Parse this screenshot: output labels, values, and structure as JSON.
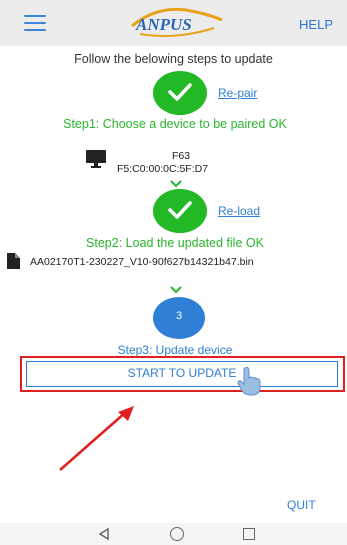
{
  "header": {
    "logo_text": "ANPUS",
    "help_label": "HELP"
  },
  "instruction": "Follow the belowing steps to update",
  "step1": {
    "link_label": "Re-pair",
    "text": "Step1: Choose a device to be paired OK",
    "device_name": "F63",
    "device_mac": "F5:C0:00:0C:5F:D7"
  },
  "step2": {
    "link_label": "Re-load",
    "text": "Step2: Load the updated file OK",
    "file_name": "AA02170T1-230227_V10-90f627b14321b47.bin"
  },
  "step3": {
    "number": "3",
    "text": "Step3: Update device",
    "button_label": "START TO UPDATE"
  },
  "quit_label": "QUIT",
  "colors": {
    "success_green": "#22b826",
    "accent_blue": "#2f7fd6",
    "highlight_red": "#e02020"
  },
  "icons": {
    "menu": "hamburger-menu-icon",
    "check": "check-icon",
    "monitor": "monitor-icon",
    "file": "file-icon",
    "chevron": "chevron-down-icon",
    "hand": "pointing-hand-icon",
    "arrow": "red-arrow-annotation-icon"
  }
}
